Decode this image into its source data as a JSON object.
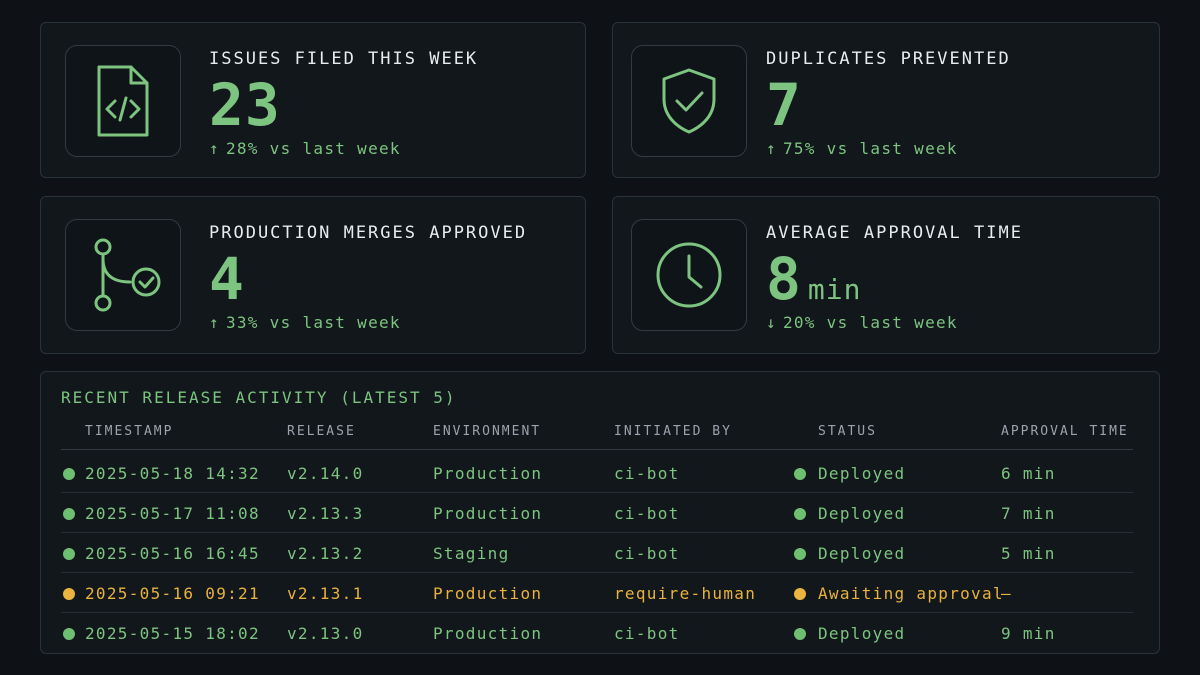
{
  "colors": {
    "accent": "#7cc47f",
    "warning": "#e8b23c",
    "text": "#e8ecef",
    "muted": "#9aa3ab",
    "background": "#0e1217"
  },
  "kpis": [
    {
      "label": "ISSUES FILED THIS WEEK",
      "value": "23",
      "unit": "",
      "direction": "up",
      "arrow": "↑",
      "delta": "28% vs last week",
      "icon": "file-code-icon"
    },
    {
      "label": "DUPLICATES PREVENTED",
      "value": "7",
      "unit": "",
      "direction": "up",
      "arrow": "↑",
      "delta": "75% vs last week",
      "icon": "shield-check-icon"
    },
    {
      "label": "PRODUCTION MERGES APPROVED",
      "value": "4",
      "unit": "",
      "direction": "up",
      "arrow": "↑",
      "delta": "33% vs last week",
      "icon": "git-merge-check-icon"
    },
    {
      "label": "AVERAGE APPROVAL TIME",
      "value": "8",
      "unit": "min",
      "direction": "down",
      "arrow": "↓",
      "delta": "20% vs last week",
      "icon": "clock-icon"
    }
  ],
  "activity": {
    "title": "RECENT RELEASE ACTIVITY (LATEST 5)",
    "columns": [
      "TIMESTAMP",
      "RELEASE",
      "ENVIRONMENT",
      "INITIATED BY",
      "STATUS",
      "APPROVAL TIME"
    ],
    "rows": [
      {
        "state": "ok",
        "timestamp": "2025-05-18 14:32",
        "release": "v2.14.0",
        "environment": "Production",
        "initiated_by": "ci-bot",
        "status": "Deployed",
        "approval_time": "6 min"
      },
      {
        "state": "ok",
        "timestamp": "2025-05-17 11:08",
        "release": "v2.13.3",
        "environment": "Production",
        "initiated_by": "ci-bot",
        "status": "Deployed",
        "approval_time": "7 min"
      },
      {
        "state": "ok",
        "timestamp": "2025-05-16 16:45",
        "release": "v2.13.2",
        "environment": "Staging",
        "initiated_by": "ci-bot",
        "status": "Deployed",
        "approval_time": "5 min"
      },
      {
        "state": "pending",
        "timestamp": "2025-05-16 09:21",
        "release": "v2.13.1",
        "environment": "Production",
        "initiated_by": "require-human",
        "status": "Awaiting approval",
        "approval_time": "—"
      },
      {
        "state": "ok",
        "timestamp": "2025-05-15 18:02",
        "release": "v2.13.0",
        "environment": "Production",
        "initiated_by": "ci-bot",
        "status": "Deployed",
        "approval_time": "9 min"
      }
    ]
  }
}
